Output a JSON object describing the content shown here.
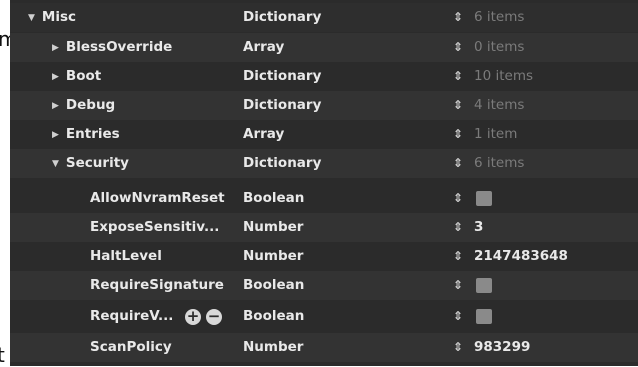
{
  "background_text": {
    "top": "m",
    "bottom": "t"
  },
  "rows": [
    {
      "key": "Misc",
      "type": "Dictionary",
      "value": "6 items",
      "level": 0,
      "disclosure": "expanded"
    },
    {
      "key": "BlessOverride",
      "type": "Array",
      "value": "0 items",
      "level": 1,
      "disclosure": "collapsed"
    },
    {
      "key": "Boot",
      "type": "Dictionary",
      "value": "10 items",
      "level": 1,
      "disclosure": "collapsed"
    },
    {
      "key": "Debug",
      "type": "Dictionary",
      "value": "4 items",
      "level": 1,
      "disclosure": "collapsed"
    },
    {
      "key": "Entries",
      "type": "Array",
      "value": "1 item",
      "level": 1,
      "disclosure": "collapsed"
    },
    {
      "key": "Security",
      "type": "Dictionary",
      "value": "6 items",
      "level": 1,
      "disclosure": "expanded"
    },
    {
      "key": "AllowNvramReset",
      "type": "Boolean",
      "value": "",
      "level": 2,
      "checkbox": true
    },
    {
      "key": "ExposeSensitiv...",
      "type": "Number",
      "value": "3",
      "level": 2
    },
    {
      "key": "HaltLevel",
      "type": "Number",
      "value": "2147483648",
      "level": 2
    },
    {
      "key": "RequireSignature",
      "type": "Boolean",
      "value": "",
      "level": 2,
      "checkbox": true
    },
    {
      "key": "RequireV...",
      "type": "Boolean",
      "value": "",
      "level": 2,
      "checkbox": true,
      "row_controls": true
    },
    {
      "key": "ScanPolicy",
      "type": "Number",
      "value": "983299",
      "level": 2
    }
  ],
  "icons": {
    "expanded": "disclosure-triangle-down-icon",
    "collapsed": "disclosure-triangle-right-icon",
    "stepper": "up-down-stepper-icon",
    "add": "add-circle-icon",
    "remove": "remove-circle-icon"
  },
  "colors": {
    "panel_bg": "#2b2b2b",
    "row_alt": "#333333",
    "text": "#e9e9e9",
    "dim_text": "#7b7b7b",
    "checkbox": "#8a8a8a"
  }
}
